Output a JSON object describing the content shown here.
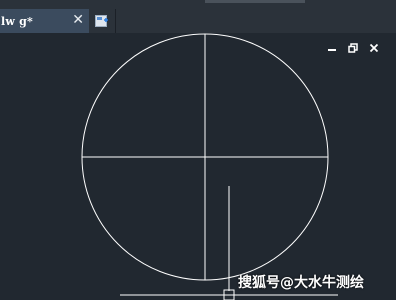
{
  "window": {
    "tab_label": "lw g*",
    "tab_close_icon": "close-icon",
    "new_tab_icon": "new-tab-icon"
  },
  "viewport_controls": {
    "minimize_icon": "minimize-icon",
    "restore_icon": "restore-icon",
    "close_icon": "close-icon"
  },
  "watermark": "搜狐号@大水牛测绘",
  "colors": {
    "background": "#212830",
    "tab_active": "#3b4b5e",
    "tab_bar": "#2b323a",
    "geometry": "#ffffff"
  }
}
